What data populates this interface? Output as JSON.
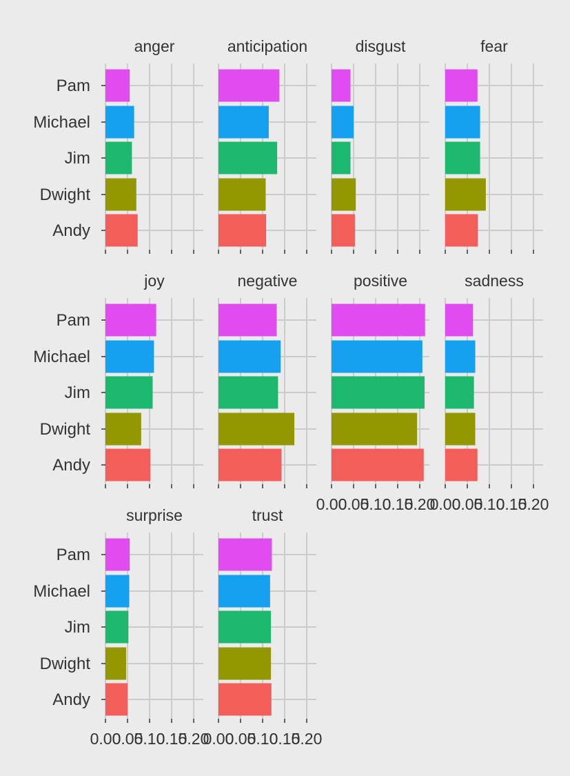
{
  "chart_data": {
    "type": "bar",
    "orientation": "horizontal",
    "facets": [
      "anger",
      "anticipation",
      "disgust",
      "fear",
      "joy",
      "negative",
      "positive",
      "sadness",
      "surprise",
      "trust"
    ],
    "categories": [
      "Pam",
      "Michael",
      "Jim",
      "Dwight",
      "Andy"
    ],
    "colors": {
      "Pam": "#e04cef",
      "Michael": "#16a1f0",
      "Jim": "#1bb86e",
      "Dwight": "#939800",
      "Andy": "#f45e5a"
    },
    "values": {
      "anger": {
        "Pam": 0.055,
        "Michael": 0.065,
        "Jim": 0.06,
        "Dwight": 0.07,
        "Andy": 0.073
      },
      "anticipation": {
        "Pam": 0.138,
        "Michael": 0.114,
        "Jim": 0.133,
        "Dwight": 0.107,
        "Andy": 0.108
      },
      "disgust": {
        "Pam": 0.043,
        "Michael": 0.05,
        "Jim": 0.043,
        "Dwight": 0.055,
        "Andy": 0.053
      },
      "fear": {
        "Pam": 0.073,
        "Michael": 0.079,
        "Jim": 0.079,
        "Dwight": 0.092,
        "Andy": 0.074
      },
      "joy": {
        "Pam": 0.115,
        "Michael": 0.11,
        "Jim": 0.107,
        "Dwight": 0.081,
        "Andy": 0.102
      },
      "negative": {
        "Pam": 0.132,
        "Michael": 0.141,
        "Jim": 0.135,
        "Dwight": 0.172,
        "Andy": 0.143
      },
      "positive": {
        "Pam": 0.212,
        "Michael": 0.206,
        "Jim": 0.211,
        "Dwight": 0.194,
        "Andy": 0.209
      },
      "sadness": {
        "Pam": 0.063,
        "Michael": 0.068,
        "Jim": 0.065,
        "Dwight": 0.068,
        "Andy": 0.073
      },
      "surprise": {
        "Pam": 0.055,
        "Michael": 0.054,
        "Jim": 0.052,
        "Dwight": 0.047,
        "Andy": 0.05
      },
      "trust": {
        "Pam": 0.121,
        "Michael": 0.117,
        "Jim": 0.119,
        "Dwight": 0.119,
        "Andy": 0.12
      }
    },
    "x_ticks": [
      "0.00",
      "0.05",
      "0.10",
      "0.15",
      "0.20"
    ],
    "xlim": [
      0,
      0.22
    ],
    "xlabel": "",
    "ylabel": "",
    "grid": true,
    "legend": "none"
  }
}
